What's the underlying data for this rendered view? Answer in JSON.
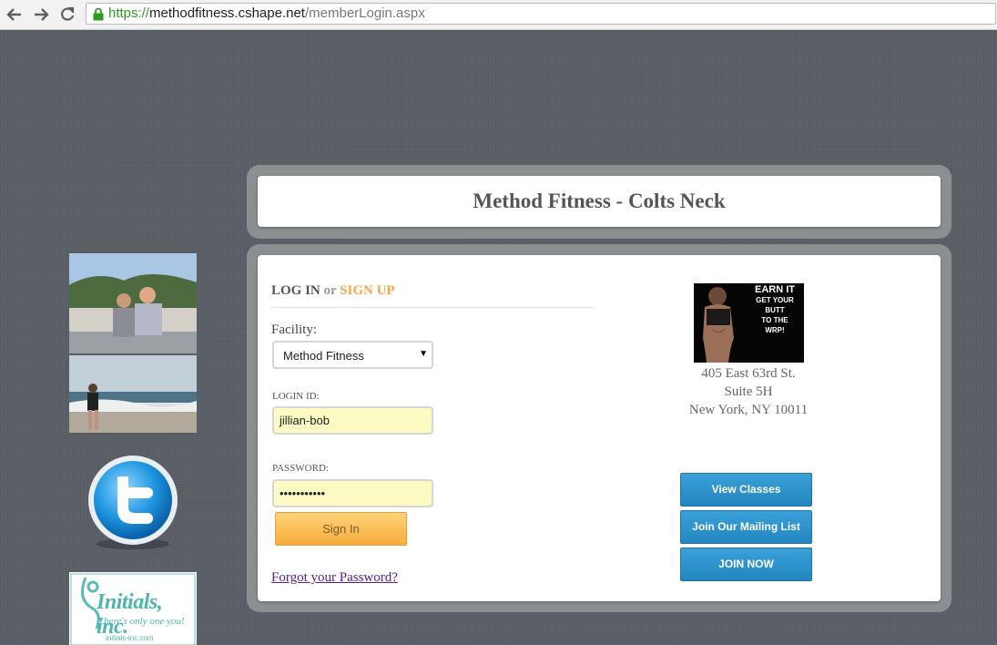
{
  "browser": {
    "url_scheme": "https://",
    "url_host": "methodfitness.cshape.net",
    "url_path": "/memberLogin.aspx",
    "back_icon": "back-arrow-icon",
    "forward_icon": "forward-arrow-icon",
    "reload_icon": "reload-icon",
    "secure_color": "#2a9d1f"
  },
  "header": {
    "title": "Method Fitness - Colts Neck"
  },
  "login": {
    "login_label": "LOG IN",
    "or_label": "or",
    "signup_label": "SIGN UP",
    "facility_label": "Facility:",
    "facility_value": "Method Fitness",
    "login_id_label": "LOGIN ID:",
    "login_id_value": "jillian-bob",
    "password_label": "PASSWORD:",
    "password_value": "•••••••••••",
    "sign_in_label": "Sign In",
    "forgot_label": "Forgot your Password?"
  },
  "promo": {
    "line1": "EARN IT",
    "line2": "GET YOUR",
    "line3": "BUTT",
    "line4": "TO THE",
    "line5": "WRP!"
  },
  "address": {
    "line1": "405 East 63rd St.",
    "line2": "Suite 5H",
    "line3": "New York, NY 10011"
  },
  "actions": {
    "view_classes": "View Classes",
    "mailing_list": "Join Our Mailing List",
    "join_now": "JOIN NOW"
  },
  "sidebar": {
    "initials_logo_text": "Initials, inc.",
    "initials_tagline": "There's only one you!",
    "initials_url": "initials-inc.com"
  },
  "colors": {
    "accent_orange": "#f5a742",
    "button_blue": "#2a8fca",
    "page_bg": "#5a5f66"
  }
}
